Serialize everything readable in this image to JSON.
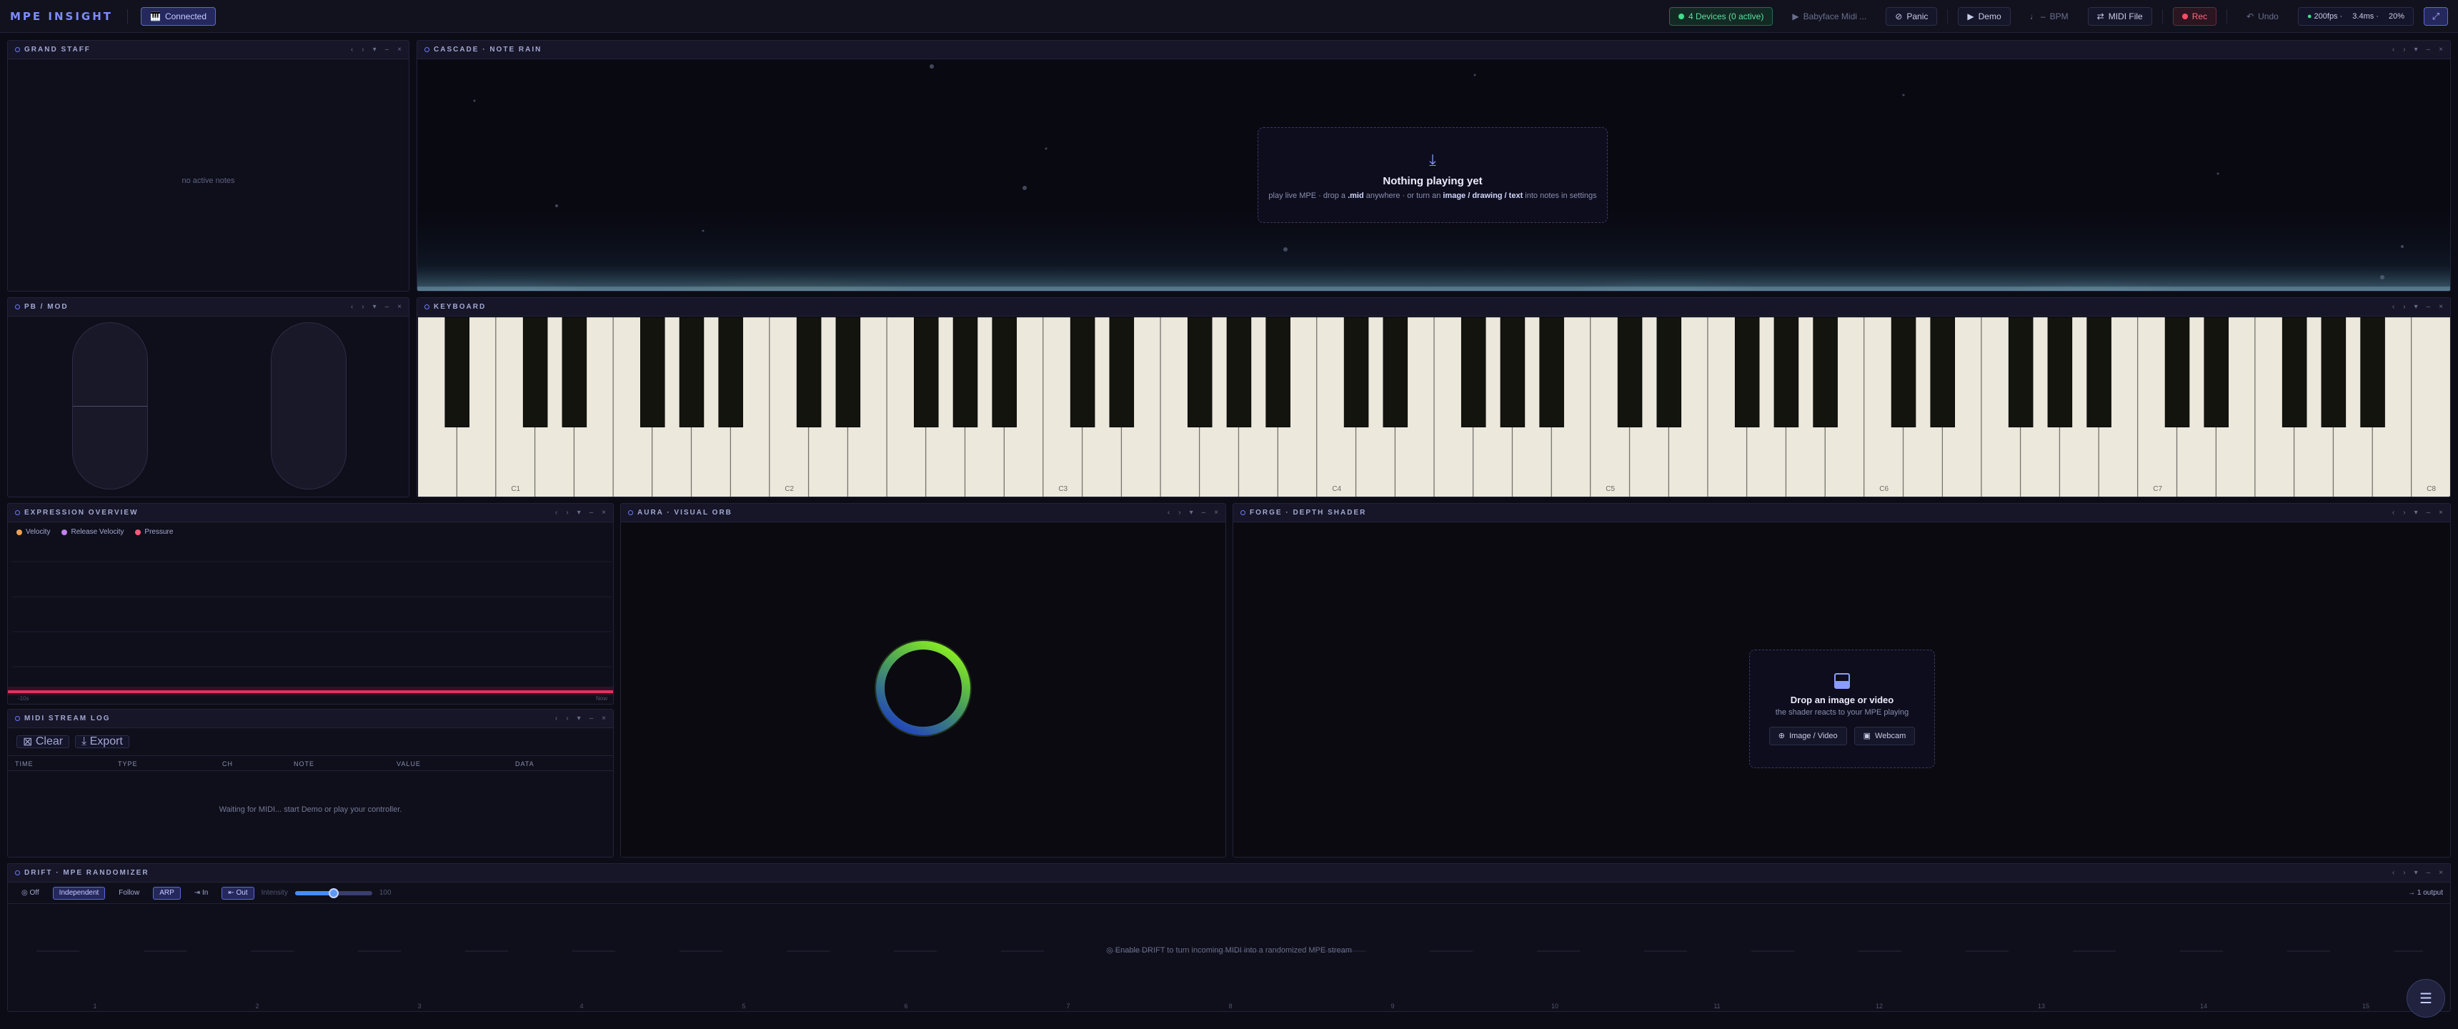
{
  "app": {
    "title": "MPE INSIGHT"
  },
  "topbar": {
    "connected": "Connected",
    "devices": "4 Devices (0 active)",
    "device_select": "Babyface Midi ...",
    "panic": "Panic",
    "demo": "Demo",
    "bpm": "BPM",
    "bpm_prefix": "♩ –",
    "midi_file": "MIDI File",
    "rec": "Rec",
    "undo": "Undo",
    "fps": "200fps ·",
    "latency": "3.4ms ·",
    "cpu": "20%"
  },
  "panels": {
    "grand_staff": {
      "title": "GRAND STAFF",
      "empty": "no active notes"
    },
    "cascade": {
      "title": "CASCADE · NOTE RAIN",
      "empty_title": "Nothing playing yet",
      "empty_sub_a": "play live MPE · drop a ",
      "empty_sub_mid": ".mid",
      "empty_sub_b": " anywhere · or turn an ",
      "empty_sub_img": "image / drawing / text",
      "empty_sub_c": " into notes in settings"
    },
    "pbmod": {
      "title": "PB / MOD"
    },
    "keyboard": {
      "title": "KEYBOARD",
      "octave_labels": [
        "C1",
        "C2",
        "C3",
        "C4",
        "C5",
        "C6",
        "C7",
        "C8"
      ]
    },
    "expression": {
      "title": "EXPRESSION OVERVIEW",
      "legend": [
        {
          "label": "Velocity",
          "color": "#f0a050"
        },
        {
          "label": "Release Velocity",
          "color": "#c080f0"
        },
        {
          "label": "Pressure",
          "color": "#ff5a7a"
        }
      ],
      "axis_left": "-10s",
      "axis_right": "Now"
    },
    "aura": {
      "title": "AURA · VISUAL ORB"
    },
    "forge": {
      "title": "FORGE · DEPTH SHADER",
      "drop_title": "Drop an image or video",
      "drop_sub": "the shader reacts to your MPE playing",
      "image_btn": "Image / Video",
      "webcam_btn": "Webcam"
    },
    "midi_log": {
      "title": "MIDI STREAM LOG",
      "clear": "Clear",
      "export": "Export",
      "columns": [
        "TIME",
        "TYPE",
        "CH",
        "NOTE",
        "VALUE",
        "DATA"
      ],
      "empty": "Waiting for MIDI... start Demo or play your controller."
    },
    "drift": {
      "title": "DRIFT · MPE RANDOMIZER",
      "off": "Off",
      "independent": "Independent",
      "follow": "Follow",
      "arp": "ARP",
      "in": "In",
      "out": "Out",
      "intensity_label": "Intensity",
      "intensity_value": "100",
      "intensity_pct": 1.0,
      "outputs": "→ 1 output",
      "empty": "◎ Enable DRIFT to turn incoming MIDI into a randomized MPE stream",
      "channels": [
        "1",
        "2",
        "3",
        "4",
        "5",
        "6",
        "7",
        "8",
        "9",
        "10",
        "11",
        "12",
        "13",
        "14",
        "15"
      ]
    }
  },
  "panel_controls": [
    "‹",
    "›",
    "▾",
    "–",
    "×"
  ],
  "menu_icon": "☰"
}
